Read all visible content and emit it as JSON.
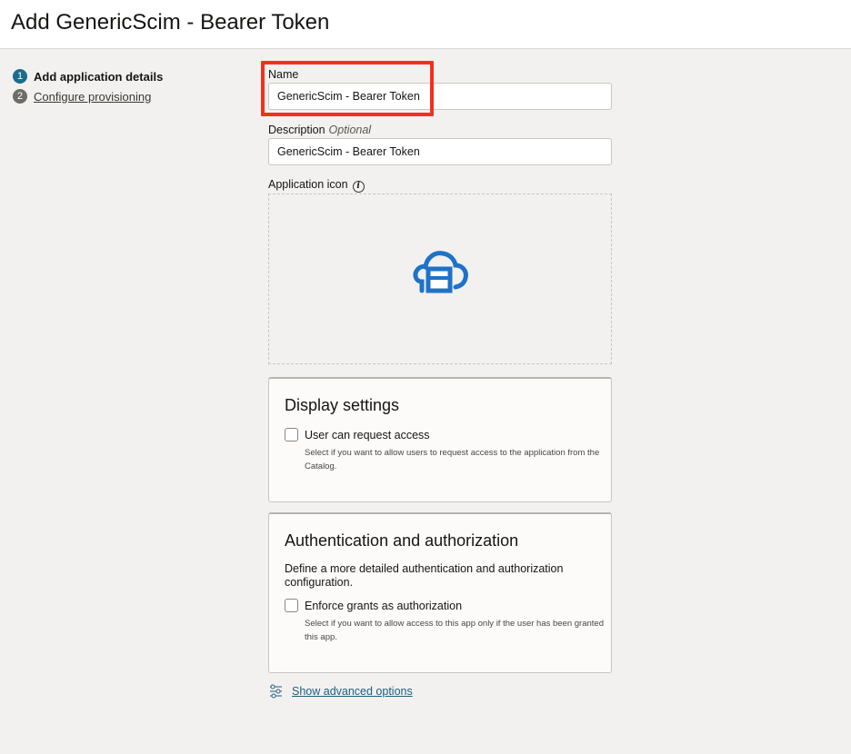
{
  "header": {
    "title": "Add GenericScim - Bearer Token"
  },
  "steps": [
    {
      "num": "1",
      "label": "Add application details"
    },
    {
      "num": "2",
      "label": "Configure provisioning"
    }
  ],
  "form": {
    "name_label": "Name",
    "name_value": "GenericScim - Bearer Token",
    "description_label": "Description",
    "description_optional": "Optional",
    "description_value": "GenericScim - Bearer Token",
    "app_icon_label": "Application icon",
    "info_glyph": "i"
  },
  "display_settings": {
    "title": "Display settings",
    "checkbox_label": "User can request access",
    "checkbox_help": "Select if you want to allow users to request access to the application from the Catalog."
  },
  "auth": {
    "title": "Authentication and authorization",
    "description": "Define a more detailed authentication and authorization configuration.",
    "checkbox_label": "Enforce grants as authorization",
    "checkbox_help": "Select if you want to allow access to this app only if the user has been granted this app."
  },
  "advanced": {
    "label": "Show advanced options"
  },
  "colors": {
    "accent": "#1c6c8e",
    "highlight": "#f2311c",
    "icon": "#1f72c9",
    "link": "#1c5f82"
  }
}
